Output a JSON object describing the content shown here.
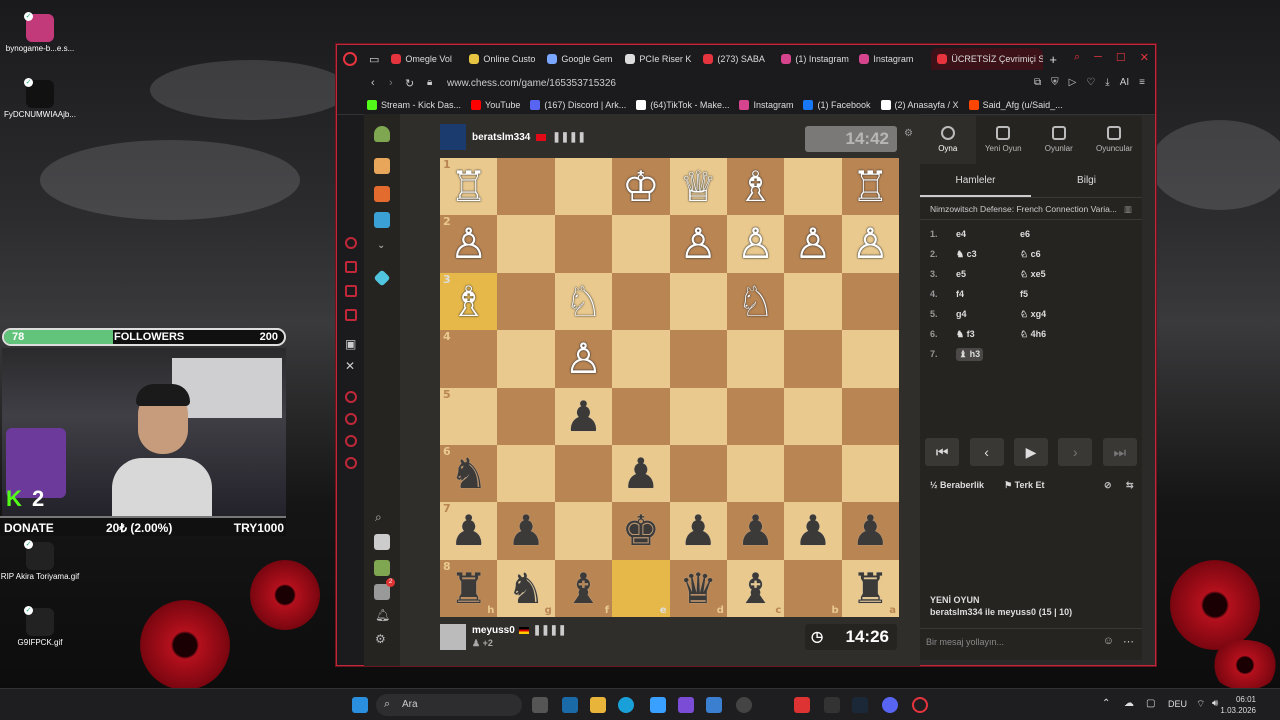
{
  "desktop": {
    "icons": [
      {
        "label": "bynogame-b...e.s..."
      },
      {
        "label": "FyDCNUMWIAAjb..."
      },
      {
        "label": "RIP Akira Toriyama.gif"
      },
      {
        "label": "G9IFPCK.gif"
      }
    ]
  },
  "stream": {
    "followers_current": "78",
    "followers_label": "FOLLOWERS",
    "followers_goal": "200",
    "followers_fraction": 0.39,
    "kick_count": "2",
    "donate_label": "DONATE",
    "donate_amount": "20₺ (2.00%)",
    "donate_goal": "TRY1000"
  },
  "browser": {
    "tabs": [
      {
        "label": "Omegle Vol",
        "color": "#e6343f"
      },
      {
        "label": "Online Custo",
        "color": "#e8c443"
      },
      {
        "label": "Google Gem",
        "color": "#7aa7ff"
      },
      {
        "label": "PCIe Riser K",
        "color": "#dddddd"
      },
      {
        "label": "(273) SABA",
        "color": "#e6343f"
      },
      {
        "label": "(1) Instagram",
        "color": "#d6448e"
      },
      {
        "label": "Instagram",
        "color": "#d6448e"
      },
      {
        "label": "ÜCRETSİZ Çevrimiçi Sa",
        "color": "#e6343f",
        "active": true
      }
    ],
    "url": "www.chess.com/game/165353715326",
    "bookmarks": [
      {
        "label": "Stream - Kick Das...",
        "color": "#53fc18"
      },
      {
        "label": "YouTube",
        "color": "#ff0000"
      },
      {
        "label": "(167) Discord | Ark...",
        "color": "#5865f2"
      },
      {
        "label": "(64)TikTok - Make...",
        "color": "#ffffff"
      },
      {
        "label": "Instagram",
        "color": "#d6448e"
      },
      {
        "label": "(1) Facebook",
        "color": "#1877f2"
      },
      {
        "label": "(2) Anasayfa / X",
        "color": "#ffffff"
      },
      {
        "label": "Said_Afg (u/Said_...",
        "color": "#ff4500"
      }
    ]
  },
  "game": {
    "top_player": {
      "name": "beratslm334",
      "clock": "14:42"
    },
    "bottom_player": {
      "name": "meyuss0",
      "clock": "14:26",
      "extra": "+2"
    },
    "ranks": [
      "1",
      "2",
      "3",
      "4",
      "5",
      "6",
      "7",
      "8"
    ],
    "files": [
      "h",
      "g",
      "f",
      "e",
      "d",
      "c",
      "b",
      "a"
    ],
    "board": [
      [
        "♖",
        "",
        "",
        "♔",
        "♕",
        "♗",
        "",
        "♖"
      ],
      [
        "♙",
        "",
        "",
        "",
        "♙",
        "♙",
        "♙",
        "♙"
      ],
      [
        "♗",
        "",
        "♘",
        "",
        "",
        "♘",
        "",
        ""
      ],
      [
        "",
        "",
        "♙",
        "",
        "",
        "",
        "",
        ""
      ],
      [
        "",
        "",
        "♟",
        "",
        "",
        "",
        "",
        ""
      ],
      [
        "♞",
        "",
        "",
        "♟",
        "",
        "",
        "",
        ""
      ],
      [
        "♟",
        "♟",
        "",
        "♚",
        "♟",
        "♟",
        "♟",
        "♟"
      ],
      [
        "♜",
        "♞",
        "♝",
        "",
        "♛",
        "♝",
        "",
        "♜"
      ]
    ]
  },
  "panel": {
    "tabs": [
      {
        "label": "Oyna",
        "icon": "stopwatch-icon",
        "active": true
      },
      {
        "label": "Yeni Oyun",
        "icon": "plus-icon"
      },
      {
        "label": "Oyunlar",
        "icon": "board-icon"
      },
      {
        "label": "Oyuncular",
        "icon": "players-icon"
      }
    ],
    "subtabs": [
      "Hamleler",
      "Bilgi"
    ],
    "opening": "Nimzowitsch Defense: French Connection Varia...",
    "moves": [
      {
        "n": "1.",
        "w": "e4",
        "b": "e6"
      },
      {
        "n": "2.",
        "w": "♞ c3",
        "b": "♘ c6"
      },
      {
        "n": "3.",
        "w": "e5",
        "b": "♘ xe5"
      },
      {
        "n": "4.",
        "w": "f4",
        "b": "f5"
      },
      {
        "n": "5.",
        "w": "g4",
        "b": "♘ xg4"
      },
      {
        "n": "6.",
        "w": "♞ f3",
        "b": "♘ 4h6"
      },
      {
        "n": "7.",
        "w": "♝ h3",
        "b": ""
      }
    ],
    "draw_label": "Beraberlik",
    "resign_label": "Terk Et",
    "new_game_title": "YENİ OYUN",
    "new_game_text": "beratslm334 ile meyuss0 (15 | 10)",
    "chat_placeholder": "Bir mesaj yollayın..."
  },
  "taskbar": {
    "search_label": "Ara",
    "lang": "DEU",
    "time": "06:01",
    "date": "1.03.2026"
  }
}
